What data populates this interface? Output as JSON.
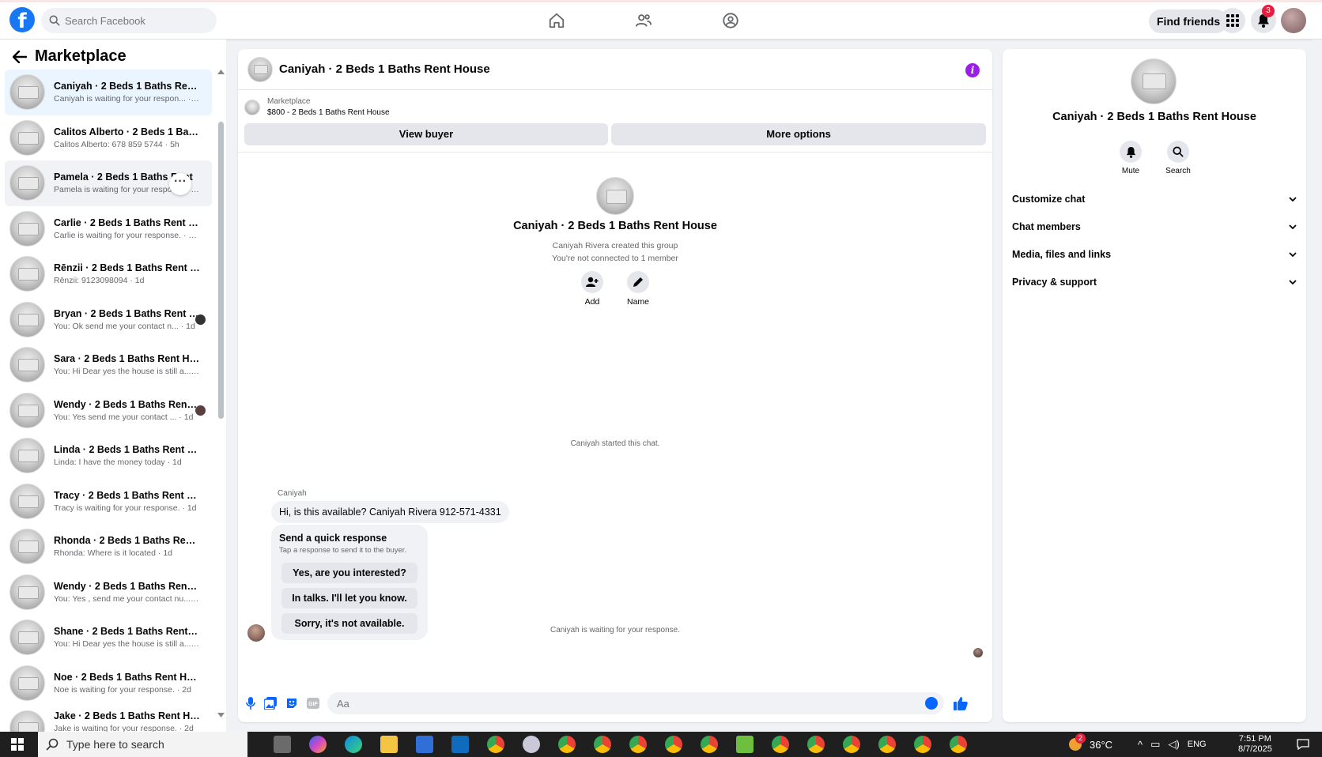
{
  "topbar": {
    "logo": "f",
    "search_placeholder": "Search Facebook",
    "find_friends": "Find friends",
    "notif_count": "3",
    "icons": [
      "facebook-logo-icon",
      "search-icon",
      "home-icon",
      "friends-icon",
      "groups-icon",
      "menu-grid-icon",
      "bell-icon"
    ]
  },
  "sidebar": {
    "title": "Marketplace",
    "conversations": [
      {
        "name": "Caniyah · 2 Beds 1 Baths Rent H...",
        "preview": "Caniyah is waiting for your respon... · 4h"
      },
      {
        "name": "Calitos Alberto · 2 Beds 1 Baths ...",
        "preview": "Calitos Alberto: 678 859 5744 · 5h"
      },
      {
        "name": "Pamela · 2 Beds 1 Baths Rent",
        "preview": "Pamela is waiting for your respon... · 12h"
      },
      {
        "name": "Carlie · 2 Beds 1 Baths Rent Hou...",
        "preview": "Carlie is waiting for your response. · 13h"
      },
      {
        "name": "Rēnzii · 2 Beds 1 Baths Rent Ho...",
        "preview": "Rēnzii: 9123098094 · 1d"
      },
      {
        "name": "Bryan · 2 Beds 1 Baths Rent H...",
        "preview": "You: Ok send me your contact n... · 1d"
      },
      {
        "name": "Sara · 2 Beds 1 Baths Rent House",
        "preview": "You: Hi Dear yes the house is still a... · 1d"
      },
      {
        "name": "Wendy · 2 Beds 1 Baths Rent ...",
        "preview": "You: Yes send me your contact ... · 1d"
      },
      {
        "name": "Linda · 2 Beds 1 Baths Rent House",
        "preview": "Linda: I have the money today · 1d"
      },
      {
        "name": "Tracy · 2 Beds 1 Baths Rent House",
        "preview": "Tracy is waiting for your response. · 1d"
      },
      {
        "name": "Rhonda · 2 Beds 1 Baths Rent H...",
        "preview": "Rhonda: Where is it located · 1d"
      },
      {
        "name": "Wendy · 2 Beds 1 Baths Rent Ho...",
        "preview": "You: Yes , send me your contact nu... · 1d"
      },
      {
        "name": "Shane · 2 Beds 1 Baths Rent Ho...",
        "preview": "You: Hi Dear yes the house is still a... · 1d"
      },
      {
        "name": "Noe · 2 Beds 1 Baths Rent House",
        "preview": "Noe is waiting for your response. · 2d"
      },
      {
        "name": "Jake · 2 Beds 1 Baths Rent House",
        "preview": "Jake is waiting for your response. · 2d"
      }
    ]
  },
  "chat": {
    "title": "Caniyah · 2 Beds 1 Baths Rent House",
    "marketplace_label": "Marketplace",
    "listing": "$800 - 2 Beds 1 Baths Rent House",
    "view_buyer": "View buyer",
    "more_options": "More options",
    "group_title": "Caniyah · 2 Beds 1 Baths Rent House",
    "created_by": "Caniyah Rivera created this group",
    "not_connected": "You're not connected to 1 member",
    "add_label": "Add",
    "name_label": "Name",
    "started": "Caniyah started this chat.",
    "sender": "Caniyah",
    "message": "Hi, is this available? Caniyah Rivera 912-571-4331",
    "quick_title": "Send a quick response",
    "quick_sub": "Tap a response to send it to the buyer.",
    "quick_replies": [
      "Yes, are you interested?",
      "In talks. I'll let you know.",
      "Sorry, it's not available."
    ],
    "waiting": "Caniyah is waiting for your response.",
    "input_placeholder": "Aa"
  },
  "rpanel": {
    "title": "Caniyah · 2 Beds 1 Baths Rent House",
    "mute": "Mute",
    "search": "Search",
    "rows": [
      "Customize chat",
      "Chat members",
      "Media, files and links",
      "Privacy & support"
    ]
  },
  "taskbar": {
    "search_placeholder": "Type here to search",
    "temp": "36°C",
    "lang": "ENG",
    "time": "7:51 PM",
    "date": "8/7/2025",
    "badge": "2"
  },
  "colors": {
    "brand": "#1877f2",
    "accent": "#0866ff",
    "info": "#9b1dea",
    "badge": "#e41e3f"
  }
}
